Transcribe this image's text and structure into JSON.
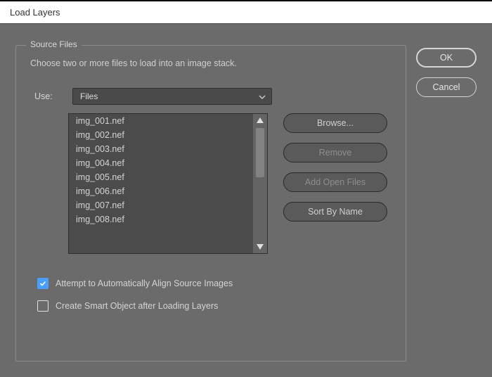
{
  "title": "Load Layers",
  "fieldset_title": "Source Files",
  "instruction": "Choose two or more files to load into an image stack.",
  "use_label": "Use:",
  "use_value": "Files",
  "files": [
    "img_001.nef",
    "img_002.nef",
    "img_003.nef",
    "img_004.nef",
    "img_005.nef",
    "img_006.nef",
    "img_007.nef",
    "img_008.nef"
  ],
  "file_buttons": {
    "browse": "Browse...",
    "remove": "Remove",
    "add_open": "Add Open Files",
    "sort": "Sort By Name"
  },
  "checkboxes": {
    "align": {
      "label": "Attempt to Automatically Align Source Images",
      "checked": true
    },
    "smart": {
      "label": "Create Smart Object after Loading Layers",
      "checked": false
    }
  },
  "actions": {
    "ok": "OK",
    "cancel": "Cancel"
  }
}
